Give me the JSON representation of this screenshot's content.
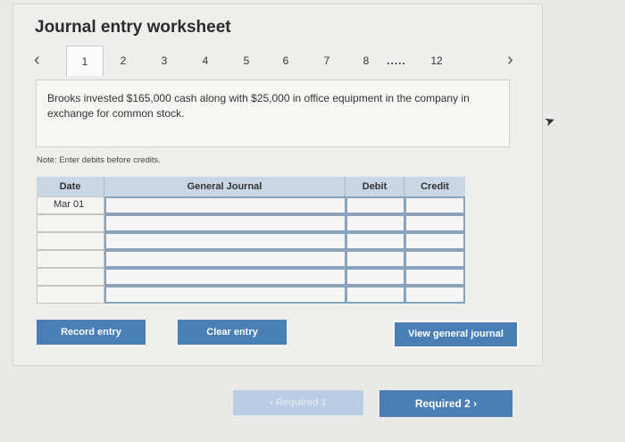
{
  "title": "Journal entry worksheet",
  "tabs": [
    "1",
    "2",
    "3",
    "4",
    "5",
    "6",
    "7",
    "8",
    "12"
  ],
  "tabs_ellipsis": ".....",
  "description": "Brooks invested $165,000 cash along with $25,000 in office equipment in the company in exchange for common stock.",
  "note": "Note: Enter debits before credits.",
  "table": {
    "headers": [
      "Date",
      "General Journal",
      "Debit",
      "Credit"
    ],
    "rows": [
      {
        "date": "Mar 01"
      },
      {
        "date": ""
      },
      {
        "date": ""
      },
      {
        "date": ""
      },
      {
        "date": ""
      },
      {
        "date": ""
      }
    ]
  },
  "buttons": {
    "record": "Record entry",
    "clear": "Clear entry",
    "view": "View general journal"
  },
  "footer": {
    "required1": "Required 1",
    "required2": "Required 2"
  },
  "icons": {
    "prev": "chevron-left-icon",
    "next": "chevron-right-icon"
  }
}
